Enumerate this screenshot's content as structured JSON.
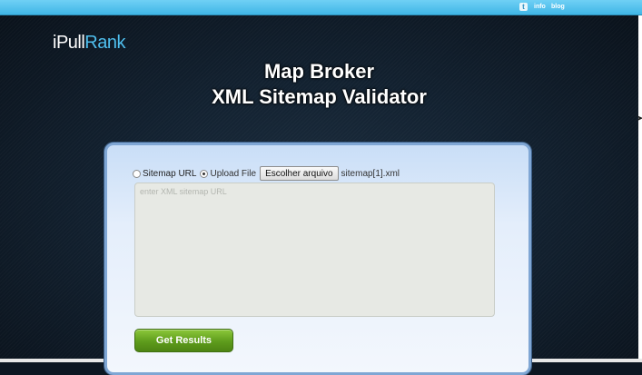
{
  "topbar": {
    "twitter_glyph": "t",
    "links": [
      "info",
      "blog"
    ],
    "icons": [
      "twitter-icon"
    ]
  },
  "brand": {
    "logo_part1": "iPull",
    "logo_part2": "Rank",
    "accent_color": "#4fbfee"
  },
  "header": {
    "title_line1": "Map Broker",
    "title_line2": "XML Sitemap Validator"
  },
  "form": {
    "options": [
      {
        "label": "Sitemap URL",
        "selected": false
      },
      {
        "label": "Upload File",
        "selected": true
      }
    ],
    "file_button_label": "Escolher arquivo",
    "file_name": "sitemap[1].xml",
    "url_placeholder": "enter XML sitemap URL",
    "url_value": "",
    "submit_label": "Get Results",
    "submit_color": "#5e9c1c"
  }
}
